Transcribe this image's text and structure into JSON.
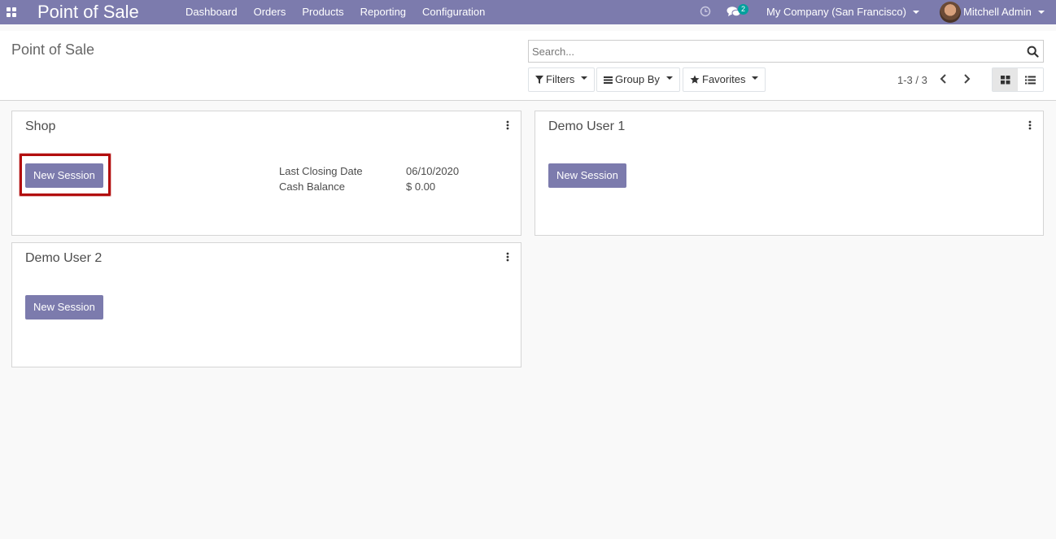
{
  "navbar": {
    "app_title": "Point of Sale",
    "menu": [
      "Dashboard",
      "Orders",
      "Products",
      "Reporting",
      "Configuration"
    ],
    "chat_badge_count": "2",
    "company": "My Company (San Francisco)",
    "user": "Mitchell Admin",
    "color": "#7c7bad"
  },
  "control_panel": {
    "title": "Point of Sale",
    "search_placeholder": "Search...",
    "filters_label": "Filters",
    "group_by_label": "Group By",
    "favorites_label": "Favorites",
    "pager": "1-3 / 3"
  },
  "cards": [
    {
      "title": "Shop",
      "button_label": "New Session",
      "highlighted": true,
      "last_closing_date_label": "Last Closing Date",
      "last_closing_date": "06/10/2020",
      "cash_balance_label": "Cash Balance",
      "cash_balance": "$ 0.00"
    },
    {
      "title": "Demo User 1",
      "button_label": "New Session"
    },
    {
      "title": "Demo User 2",
      "button_label": "New Session"
    }
  ],
  "colors": {
    "accent": "#7c7bad",
    "highlight_border": "#b20e0e",
    "badge": "#00a09d"
  }
}
